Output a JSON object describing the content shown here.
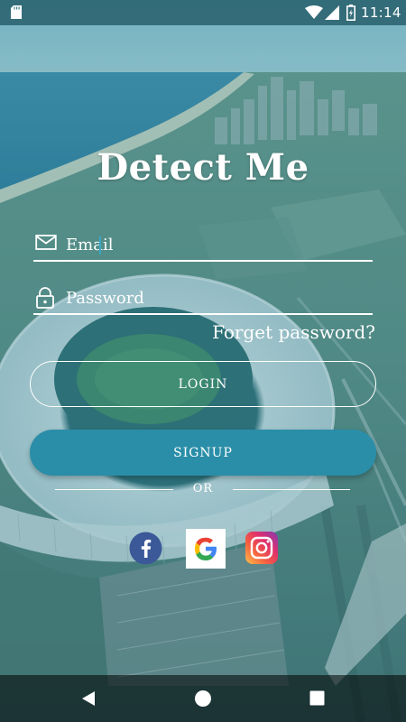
{
  "status_bar": {
    "time": "11:14",
    "icons": [
      "sd-card-icon",
      "wifi-icon",
      "signal-icon",
      "battery-charging-icon"
    ]
  },
  "app": {
    "title": "Detect Me"
  },
  "form": {
    "email_placeholder": "Email",
    "email_value": "",
    "email_icon": "mail-icon",
    "password_placeholder": "Password",
    "password_value": "",
    "password_icon": "lock-icon",
    "forgot_label": "Forget password?",
    "login_label": "LOGIN",
    "signup_label": "SIGNUP",
    "or_label": "OR"
  },
  "social": {
    "icons": [
      "facebook-icon",
      "google-icon",
      "instagram-icon"
    ]
  },
  "nav_bar": {
    "icons": [
      "back-icon",
      "home-icon",
      "recents-icon"
    ]
  },
  "colors": {
    "overlay_teal": "#2f7d8c",
    "signup_button": "#2a8ea8",
    "facebook": "#3b5998",
    "text": "#ffffff"
  }
}
